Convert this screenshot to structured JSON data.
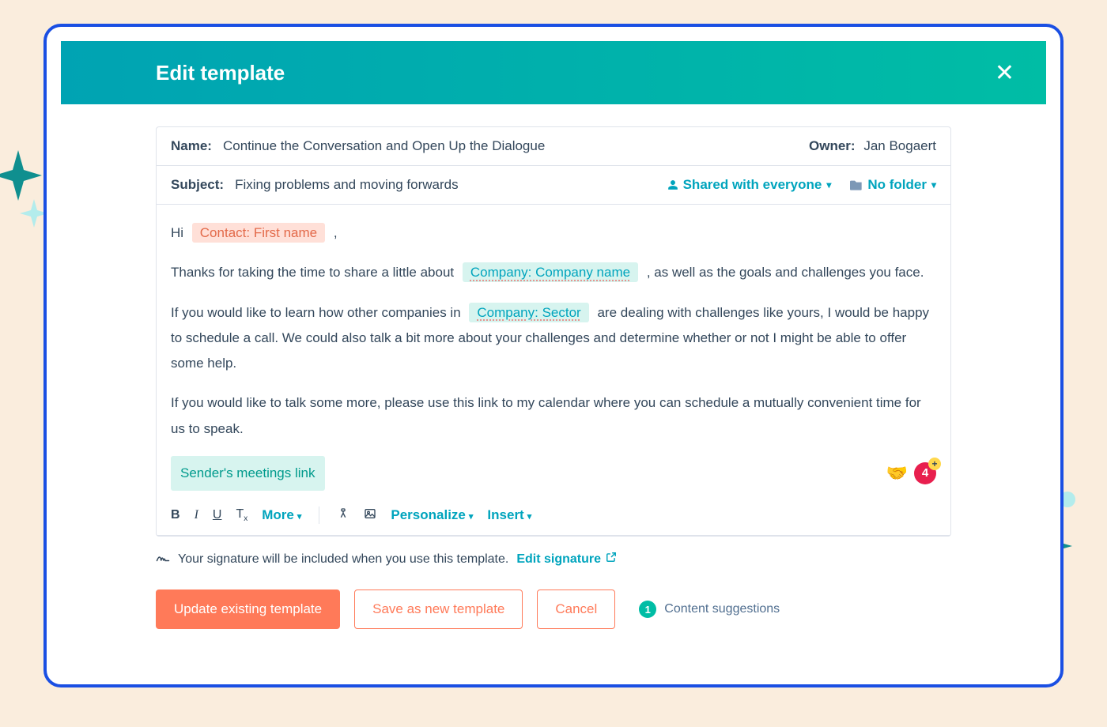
{
  "header": {
    "title": "Edit template"
  },
  "meta": {
    "name_label": "Name:",
    "name_value": "Continue the Conversation and Open Up the Dialogue",
    "owner_label": "Owner:",
    "owner_value": "Jan Bogaert",
    "subject_label": "Subject:",
    "subject_value": "Fixing problems and moving forwards",
    "shared_label": "Shared with everyone",
    "folder_label": "No folder"
  },
  "body": {
    "greeting_prefix": "Hi ",
    "greeting_token": "Contact: First name",
    "greeting_suffix": " ,",
    "p1_before": "Thanks for taking the time to share a little about ",
    "p1_token": "Company: Company name",
    "p1_after": " , as well as the goals and challenges you face.",
    "p2_before": "If you would like to learn how other companies in ",
    "p2_token": "Company: Sector",
    "p2_after": " are dealing with challenges like yours, I would be happy to schedule a call. We could also talk a bit more about your challenges and determine whether or not I might be able to offer some help.",
    "p3": "If you would like to talk some more, please use this link to my calendar where you can schedule a mutually convenient time for us to speak.",
    "meetings_token": "Sender's meetings link",
    "badge_count": "4"
  },
  "toolbar": {
    "bold": "B",
    "italic": "I",
    "underline": "U",
    "clear": "Tx",
    "more": "More",
    "personalize": "Personalize",
    "insert": "Insert"
  },
  "signature": {
    "note": "Your signature will be included when you use this template.",
    "link": "Edit signature"
  },
  "footer": {
    "update": "Update existing template",
    "save_as_new": "Save as new template",
    "cancel": "Cancel",
    "suggestions_label": "Content suggestions",
    "suggestions_count": "1"
  }
}
